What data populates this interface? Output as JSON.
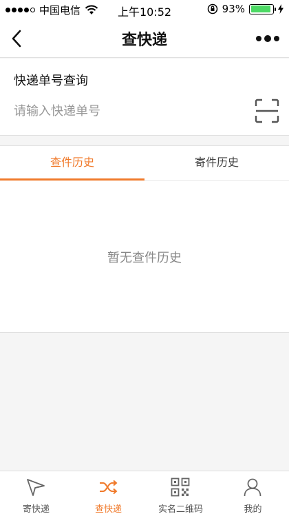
{
  "status_bar": {
    "carrier": "中国电信",
    "time": "上午10:52",
    "battery_percent": "93%",
    "battery_level": 0.93
  },
  "nav": {
    "title": "查快递"
  },
  "query": {
    "title": "快递单号查询",
    "placeholder": "请输入快递单号"
  },
  "tabs": [
    {
      "label": "查件历史",
      "active": true
    },
    {
      "label": "寄件历史",
      "active": false
    }
  ],
  "empty_message": "暂无查件历史",
  "tab_bar": {
    "items": [
      {
        "label": "寄快递",
        "icon": "paper-plane-icon",
        "active": false
      },
      {
        "label": "查快递",
        "icon": "shuffle-icon",
        "active": true
      },
      {
        "label": "实名二维码",
        "icon": "qr-code-icon",
        "active": false
      },
      {
        "label": "我的",
        "icon": "person-icon",
        "active": false
      }
    ]
  },
  "colors": {
    "accent": "#f07a2b",
    "battery": "#4cd964",
    "background": "#f5f5f5"
  }
}
